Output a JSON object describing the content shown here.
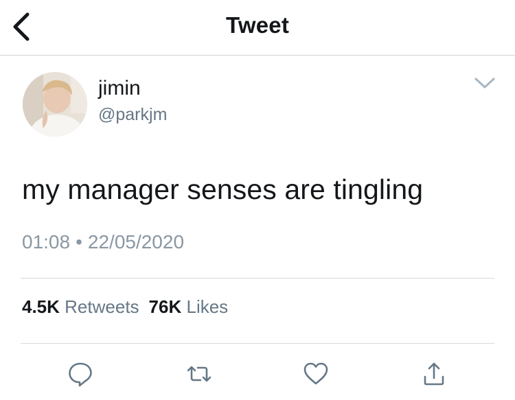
{
  "header": {
    "title": "Tweet"
  },
  "author": {
    "display_name": "jimin",
    "handle": "@parkjm"
  },
  "tweet": {
    "text": "my manager senses are tingling",
    "time": "01:08",
    "separator": "•",
    "date": "22/05/2020"
  },
  "stats": {
    "retweets_count": "4.5K",
    "retweets_label": "Retweets",
    "likes_count": "76K",
    "likes_label": "Likes"
  },
  "icons": {
    "back": "chevron-left-icon",
    "more": "chevron-down-icon",
    "reply": "reply-icon",
    "retweet": "retweet-icon",
    "like": "heart-icon",
    "share": "share-icon"
  },
  "colors": {
    "icon_gray": "#657786",
    "muted_text": "#8a97a3",
    "text": "#14171a"
  }
}
